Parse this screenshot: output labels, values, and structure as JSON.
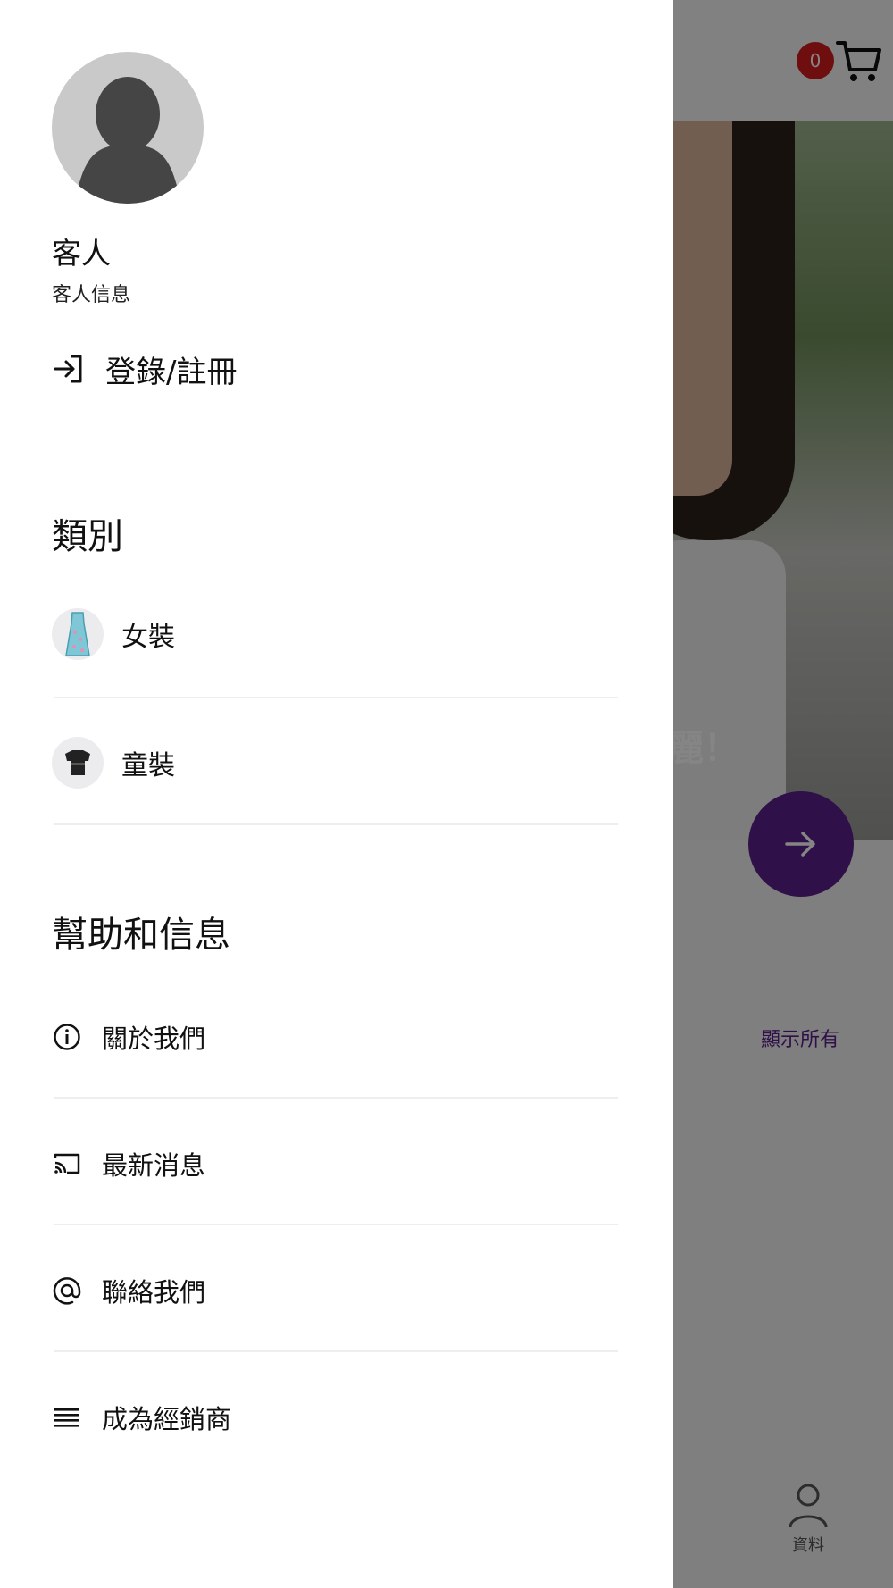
{
  "background": {
    "cart_count": "0",
    "hero_text": "麗！",
    "show_all_label": "顯示所有",
    "profile_tab_label": "資料",
    "accent_color": "#5a1f8a",
    "badge_color": "#d41c1c"
  },
  "drawer": {
    "user_name": "客人",
    "user_subtitle": "客人信息",
    "login_label": "登錄/註冊",
    "categories_title": "類別",
    "categories": [
      {
        "label": "女裝",
        "icon": "dress-icon"
      },
      {
        "label": "童裝",
        "icon": "kids-shirt-icon"
      }
    ],
    "help_title": "幫助和信息",
    "help_items": [
      {
        "label": "關於我們",
        "icon": "info-icon"
      },
      {
        "label": "最新消息",
        "icon": "cast-icon"
      },
      {
        "label": "聯絡我們",
        "icon": "at-icon"
      },
      {
        "label": "成為經銷商",
        "icon": "list-icon"
      }
    ]
  }
}
